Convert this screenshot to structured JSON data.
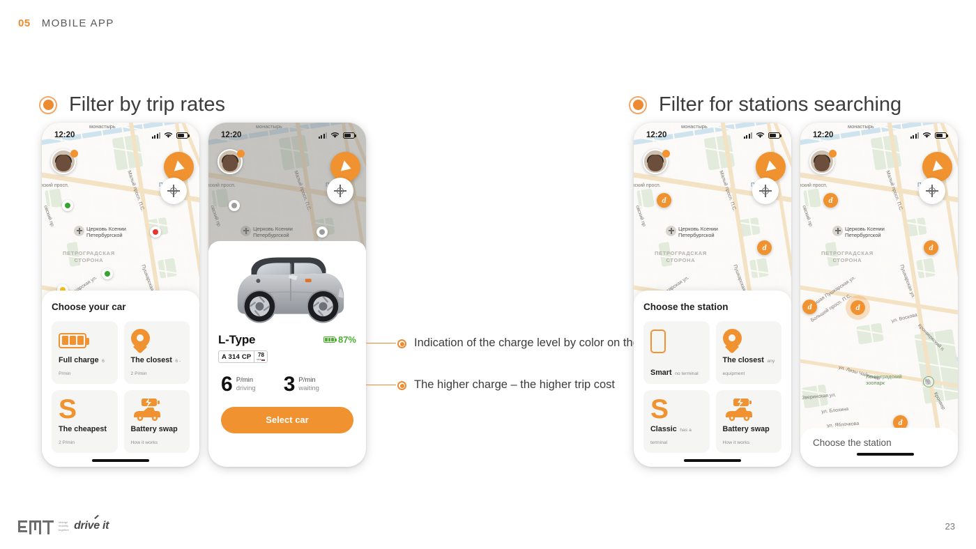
{
  "header": {
    "number": "05",
    "kicker": "MOBILE APP"
  },
  "sections": {
    "left": {
      "title": "Filter by trip rates"
    },
    "right": {
      "title": "Filter for stations searching"
    }
  },
  "status_bar": {
    "time": "12:20"
  },
  "map": {
    "labels": {
      "monastery": "монастырь",
      "kamennoostrovsky": "овский просп.",
      "maly_prospekt": "Малый просп. П.С.",
      "bolshoy_prospekt": "Большой просп. П.С.",
      "kamen_pr_short": "овский пр",
      "petrogradskaya_side": "ПЕТРОГРАДСКАЯ\nСТОРОНА",
      "church": "Церковь Ксении\nПетербургской",
      "pushkarskaya": "Пушкарская ул.",
      "bolshaya_pushkarskaya": "Большая Пушкарская ул.",
      "petrogradskaya_metro": "Пе       адс",
      "voskova": "ул. Воскова",
      "lizy_chaykinoy": "ул. Лизы Чайкиной",
      "zverinskaya": "Зверинская ул.",
      "blokhina": "ул. Блохина",
      "yablochkova": "ул. Яблочкова",
      "kronverksky": "Кронверкский п",
      "kronverk2": "Кронвер",
      "zoo": "Ленинградский\nзоопарк"
    },
    "charge_markers": [
      {
        "level": "high",
        "color": "#35a52f"
      },
      {
        "level": "low",
        "color": "#e8342a"
      },
      {
        "level": "high",
        "color": "#35a52f"
      },
      {
        "level": "medium",
        "color": "#f5c518"
      }
    ],
    "station_pin_label": "d"
  },
  "phone1": {
    "sheet_title": "Choose your car",
    "tiles": [
      {
        "icon": "battery-full-icon",
        "label": "Full charge",
        "sub": "6 P/min"
      },
      {
        "icon": "map-pin-icon",
        "label": "The closest",
        "sub": "6 - 2 P/min"
      },
      {
        "icon": "dollar-icon",
        "label": "The cheapest",
        "sub": "2 P/min"
      },
      {
        "icon": "battery-swap-icon",
        "label": "Battery swap",
        "sub": "How it works"
      }
    ]
  },
  "phone2": {
    "car_name": "L-Type",
    "plate_number": "A 314 CP",
    "plate_region": "78",
    "plate_country": "RUS",
    "charge_percent": "87%",
    "rates": [
      {
        "value": "6",
        "unit": "P/min",
        "mode": "driving"
      },
      {
        "value": "3",
        "unit": "P/min",
        "mode": "waiting"
      }
    ],
    "cta_label": "Select car"
  },
  "phone3": {
    "sheet_title": "Choose the station",
    "tiles": [
      {
        "icon": "smartphone-icon",
        "label": "Smart",
        "sub": "no terminal"
      },
      {
        "icon": "map-pin-icon",
        "label": "The closest",
        "sub": "any equipment"
      },
      {
        "icon": "dollar-icon",
        "label": "Classic",
        "sub": "has a terminal"
      },
      {
        "icon": "battery-swap-icon",
        "label": "Battery swap",
        "sub": "How it works"
      }
    ]
  },
  "phone4": {
    "search_label": "Choose the station"
  },
  "annotations": [
    {
      "text": "Indication of the charge level by color on the map"
    },
    {
      "text": "The higher charge – the higher trip cost"
    }
  ],
  "footer": {
    "brand": "EMT",
    "tagline": "change\nmobility\ntogether",
    "product": "drive it",
    "page": "23"
  },
  "colors": {
    "accent": "#F0922F",
    "accent_dark": "#ED8B33",
    "charge_high": "#35a52f",
    "charge_medium": "#f5c518",
    "charge_low": "#e8342a"
  }
}
